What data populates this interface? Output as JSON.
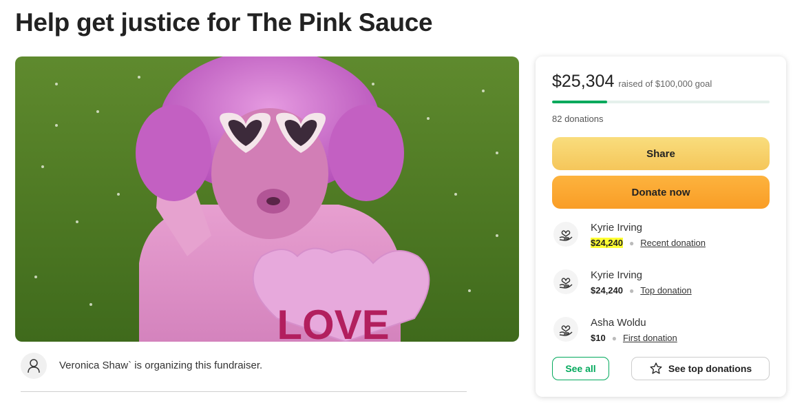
{
  "page": {
    "title": "Help get justice for The Pink Sauce"
  },
  "hero": {
    "image_icon": "fundraiser-photo",
    "heart_text": "LOVE"
  },
  "organizer": {
    "icon": "person-icon",
    "text": "Veronica Shaw` is organizing this fundraiser."
  },
  "card": {
    "raised": "$25,304",
    "goal_text": "raised of $100,000 goal",
    "progress_fraction": 0.253,
    "donations_count": "82 donations",
    "share_label": "Share",
    "donate_label": "Donate now",
    "donations": [
      {
        "name": "Kyrie Irving",
        "amount": "$24,240",
        "tag": "Recent donation",
        "highlighted": true
      },
      {
        "name": "Kyrie Irving",
        "amount": "$24,240",
        "tag": "Top donation",
        "highlighted": false
      },
      {
        "name": "Asha Woldu",
        "amount": "$10",
        "tag": "First donation",
        "highlighted": false
      }
    ],
    "see_all_label": "See all",
    "see_top_label": "See top donations"
  },
  "colors": {
    "brand_green": "#02a95c",
    "share_yellow": "#f7d26c",
    "donate_orange": "#fba733",
    "highlight": "#ffff33"
  }
}
